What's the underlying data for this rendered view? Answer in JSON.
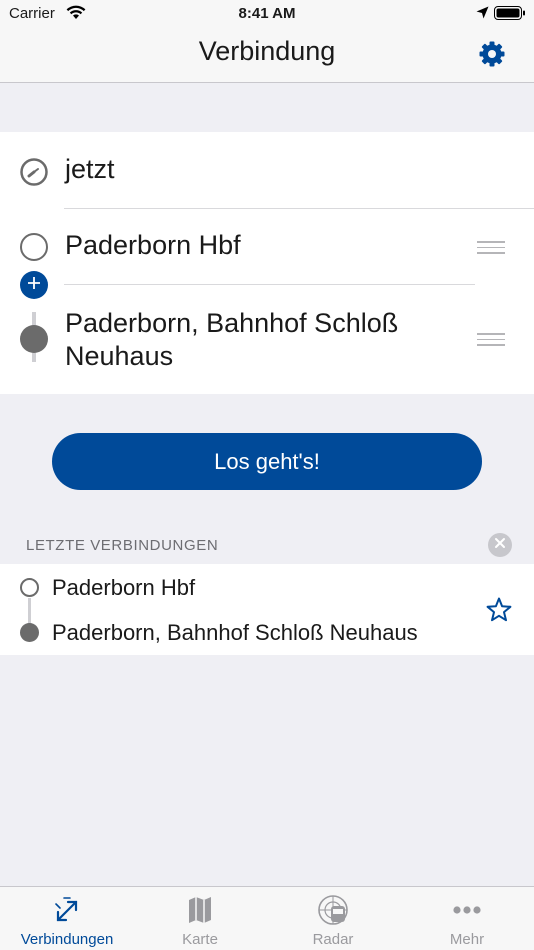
{
  "status_bar": {
    "carrier": "Carrier",
    "time": "8:41 AM",
    "wifi_icon": "wifi-icon",
    "location_icon": "location-arrow-icon",
    "battery_icon": "battery-icon"
  },
  "nav": {
    "title": "Verbindung",
    "settings_icon": "gear-icon"
  },
  "search": {
    "time_label": "jetzt",
    "origin": "Paderborn Hbf",
    "destination": "Paderborn, Bahnhof Schloß Neuhaus",
    "submit_label": "Los geht's!"
  },
  "recent": {
    "header": "LETZTE VERBINDUNGEN",
    "items": [
      {
        "from": "Paderborn Hbf",
        "to": "Paderborn, Bahnhof Schloß Neuhaus"
      }
    ]
  },
  "tabs": [
    {
      "label": "Verbindungen",
      "icon": "connections-icon",
      "active": true
    },
    {
      "label": "Karte",
      "icon": "map-icon",
      "active": false
    },
    {
      "label": "Radar",
      "icon": "radar-icon",
      "active": false
    },
    {
      "label": "Mehr",
      "icon": "more-icon",
      "active": false
    }
  ],
  "colors": {
    "accent": "#004a99",
    "background": "#efeff4",
    "inactive_tab": "#9a9a9e"
  }
}
